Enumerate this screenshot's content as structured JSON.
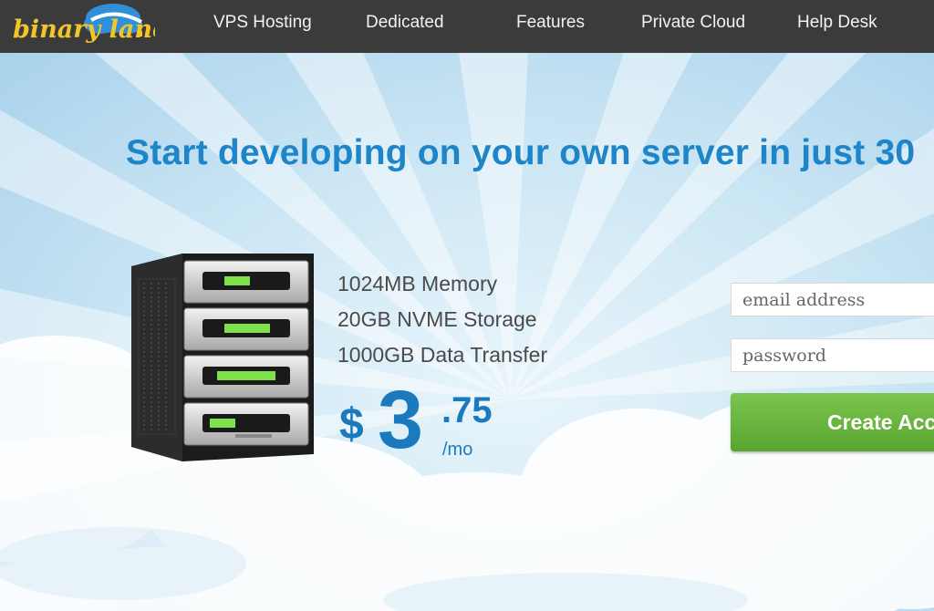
{
  "brand": {
    "logo_text": "binary lane"
  },
  "nav": {
    "items": [
      {
        "label": "VPS Hosting"
      },
      {
        "label": "Dedicated"
      },
      {
        "label": "Features"
      },
      {
        "label": "Private Cloud"
      },
      {
        "label": "Help Desk"
      }
    ]
  },
  "hero": {
    "headline": "Start developing on your own server in just 30",
    "specs": [
      "1024MB Memory",
      "20GB NVME Storage",
      "1000GB Data Transfer"
    ],
    "price": {
      "currency": "$",
      "whole": "3",
      "cents": ".75",
      "period": "/mo"
    }
  },
  "signup": {
    "email_placeholder": "email address",
    "password_placeholder": "password",
    "button_label": "Create Account"
  },
  "colors": {
    "nav_bg": "#3b3b3b",
    "accent_blue": "#1e86c8",
    "cta_green": "#6ab53f",
    "led_green": "#7ee04a"
  }
}
